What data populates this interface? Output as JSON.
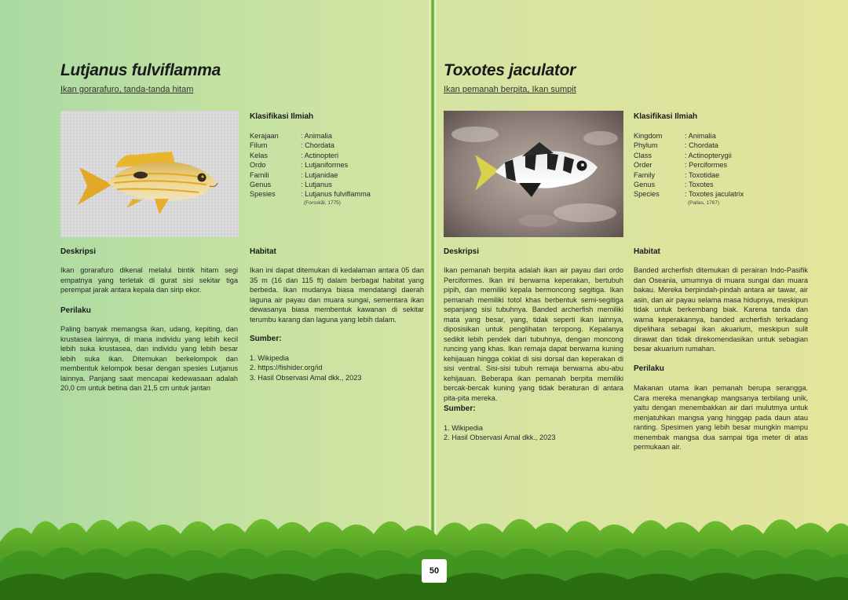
{
  "left": {
    "title": "Lutjanus fulviflamma",
    "subtitle": "Ikan gorarafuro, tanda-tanda hitam",
    "classification_heading": "Klasifikasi Ilmiah",
    "taxonomy": [
      {
        "key": "Kerajaan",
        "value": ": Animalia"
      },
      {
        "key": "Filum",
        "value": ": Chordata"
      },
      {
        "key": "Kelas",
        "value": ": Actinopteri"
      },
      {
        "key": "Ordo",
        "value": ": Lutjaniformes"
      },
      {
        "key": "Famili",
        "value": ": Lutjanidae"
      },
      {
        "key": "Genus",
        "value": ": Lutjanus"
      },
      {
        "key": "Spesies",
        "value": ": Lutjanus fulviflamma"
      }
    ],
    "author": "(Forsskål, 1775)",
    "description_heading": "Deskripsi",
    "description": "Ikan gorarafuro dikenal melalui bintik hitam segi empatnya yang terletak di gurat sisi sekitar tiga perempat jarak antara kepala dan sirip ekor.",
    "behavior_heading": "Perilaku",
    "behavior": "Paling banyak memangsa ikan, udang, kepiting, dan krustasea lainnya, di mana individu yang lebih kecil lebih suka krustasea, dan individu yang lebih besar lebih suka ikan. Ditemukan berkelompok dan membentuk kelompok besar dengan spesies Lutjanus lainnya. Panjang saat mencapai kedewasaan adalah 20,0 cm untuk betina dan 21,5 cm untuk jantan",
    "habitat_heading": "Habitat",
    "habitat": "Ikan ini dapat ditemukan di kedalaman antara 05 dan 35 m (16 dan 115 ft) dalam berbagai habitat yang berbeda. Ikan mudanya biasa mendatangi daerah laguna air payau dan muara sungai, sementara ikan dewasanya biasa membentuk kawanan di sekitar terumbu karang dan laguna yang lebih dalam.",
    "sources_heading": "Sumber:",
    "sources": [
      "1. Wikipedia",
      "2. https://fishider.org/id",
      "3. Hasil Observasi Amal dkk., 2023"
    ]
  },
  "right": {
    "title": "Toxotes jaculator",
    "subtitle": "Ikan pemanah berpita, Ikan sumpit",
    "classification_heading": "Klasifikasi Ilmiah",
    "taxonomy": [
      {
        "key": "Kingdom",
        "value": ": Animalia"
      },
      {
        "key": "Phylum",
        "value": ": Chordata"
      },
      {
        "key": "Class",
        "value": ": Actinopterygii"
      },
      {
        "key": "Order",
        "value": ": Perciformes"
      },
      {
        "key": "Family",
        "value": ": Toxotidae"
      },
      {
        "key": "Genus",
        "value": ": Toxotes"
      },
      {
        "key": "Species",
        "value": ": Toxotes jaculatrix"
      }
    ],
    "author": "(Pallas, 1767)",
    "description_heading": "Deskripsi",
    "description": "Ikan pemanah berpita adalah ikan air payau dari ordo Perciformes. Ikan ini berwarna keperakan, bertubuh pipih, dan memiliki kepala bermoncong segitiga. Ikan pemanah memiliki totol khas berbentuk semi-segitiga sepanjang sisi tubuhnya. Banded archerfish memiliki mata yang besar, yang, tidak seperti ikan lainnya, diposisikan untuk penglihatan teropong. Kepalanya sedikit lebih pendek dari tubuhnya, dengan moncong runcing yang khas. Ikan remaja dapat berwarna kuning kehijauan hingga coklat di sisi dorsal dan keperakan di sisi ventral. Sisi-sisi tubuh remaja berwarna abu-abu kehijauan. Beberapa ikan pemanah berpita memiliki bercak-bercak kuning yang tidak beraturan di antara pita-pita mereka.",
    "sources_heading": "Sumber:",
    "sources": [
      "1. Wikipedia",
      "2. Hasil Observasi Amal dkk., 2023"
    ],
    "habitat_heading": "Habitat",
    "habitat": "Banded archerfish ditemukan di perairan Indo-Pasifik dan Oseania, umumnya di muara sungai dan muara bakau. Mereka berpindah-pindah antara air tawar, air asin, dan air payau selama masa hidupnya, meskipun tidak untuk berkembang biak. Karena tanda dan warna keperakannya, banded archerfish terkadang dipelihara sebagai ikan akuarium, meskipun sulit dirawat dan tidak direkomendasikan untuk sebagian besar akuarium rumahan.",
    "behavior_heading": "Perilaku",
    "behavior": "Makanan utama ikan pemanah berupa serangga. Cara mereka menangkap mangsanya terbilang unik, yaitu dengan menembakkan air dari mulutmya untuk menjatuhkan mangsa yang hinggap pada daun atau ranting. Spesimen yang lebih besar mungkin mampu menembak mangsa dua sampai tiga meter di atas permukaan air."
  },
  "page_number": "50"
}
